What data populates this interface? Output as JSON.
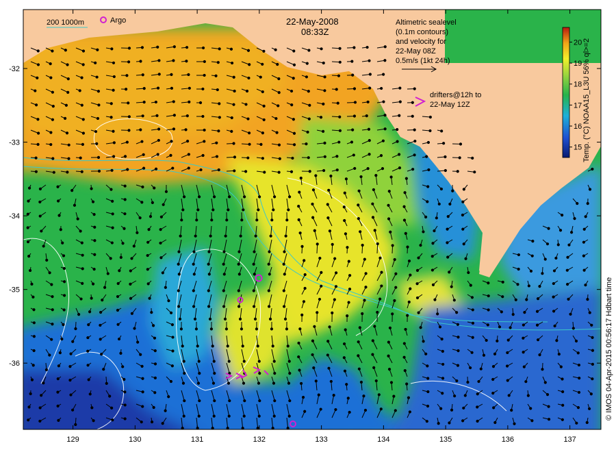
{
  "map": {
    "date": "22-May-2008",
    "time": "08:33Z",
    "legend_isobaths": "200  1000m",
    "legend_argo": "Argo",
    "altimetry_note": [
      "Altimetric sealevel",
      "(0.1m contours)",
      "and velocity for",
      "22-May 08Z",
      "0.5m/s (1kt 24h)"
    ],
    "drifters_note": [
      "drifters@12h to",
      "22-May 12Z"
    ],
    "colorbar_label": "Temp. (°C) NOAA15_L3U 56% ql>=2",
    "colorbar_ticks": [
      "15",
      "16",
      "17",
      "18",
      "19",
      "20"
    ],
    "credit": "© IMOS 04-Apr-2015 00:56:17 Hdbart time",
    "x_ticks": [
      "129",
      "130",
      "131",
      "132",
      "133",
      "134",
      "135",
      "136",
      "137"
    ],
    "y_ticks": [
      "-32",
      "-33",
      "-34",
      "-35",
      "-36"
    ],
    "lon_range": [
      128.2,
      137.5
    ],
    "lat_range": [
      -36.9,
      -31.2
    ],
    "colors": {
      "land": "#f8c99e",
      "warm": "#f2a420",
      "mid": "#2ab34a",
      "cool": "#1f6fd6",
      "cold": "#162f8f",
      "argo": "#d020d0",
      "isobath": "#3cc8c8",
      "contour": "#ffffff"
    }
  }
}
